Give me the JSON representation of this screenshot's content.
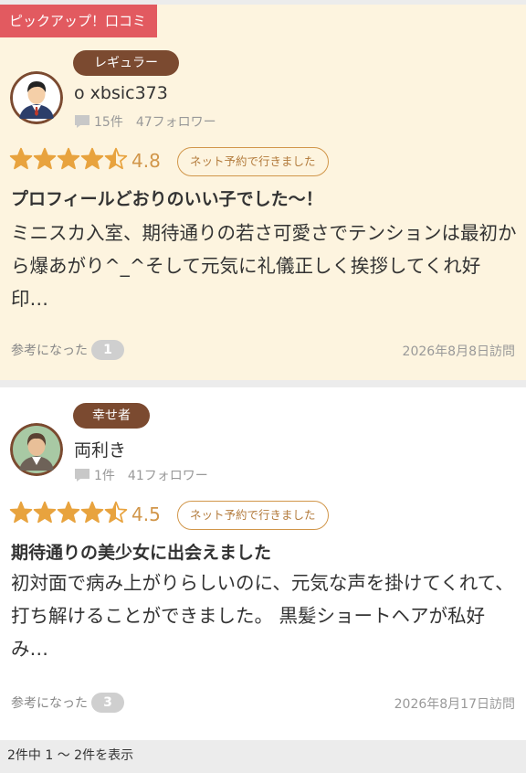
{
  "pickup_label": "ピックアップ！口コミ",
  "reviews": [
    {
      "badge": "レギュラー",
      "username": "o xbsic373",
      "post_count": "15件",
      "followers": "47フォロワー",
      "rating": 4.5,
      "rating_text": "4.8",
      "reservation_badge": "ネット予約で行きました",
      "title": "プロフィールどおりのいい子でした〜！",
      "body": "ミニスカ入室、期待通りの若さ可愛さでテンションは最初から爆あがり^_^そして元気に礼儀正しく挨拶してくれ好印…",
      "helpful_label": "参考になった",
      "helpful_count": "1",
      "visit_date": "2026年8月8日訪問"
    },
    {
      "badge": "幸せ者",
      "username": "両利き",
      "post_count": "1件",
      "followers": "41フォロワー",
      "rating": 4.5,
      "rating_text": "4.5",
      "reservation_badge": "ネット予約で行きました",
      "title": "期待通りの美少女に出会えました",
      "body": "初対面で病み上がりらしいのに、元気な声を掛けてくれて、打ち解けることができました。 黒髪ショートヘアが私好み…",
      "helpful_label": "参考になった",
      "helpful_count": "3",
      "visit_date": "2026年8月17日訪問"
    }
  ],
  "pagination_text": "2件中 1 〜 2件を表示",
  "colors": {
    "pickup_bg": "#e25a60",
    "card_highlight_bg": "#fdf4df",
    "badge_bg": "#7b4a30",
    "star_color": "#e8a33e",
    "accent": "#d1964a"
  },
  "icons": [
    "user-avatar-icon",
    "comment-icon",
    "star-icon",
    "half-star-icon"
  ]
}
